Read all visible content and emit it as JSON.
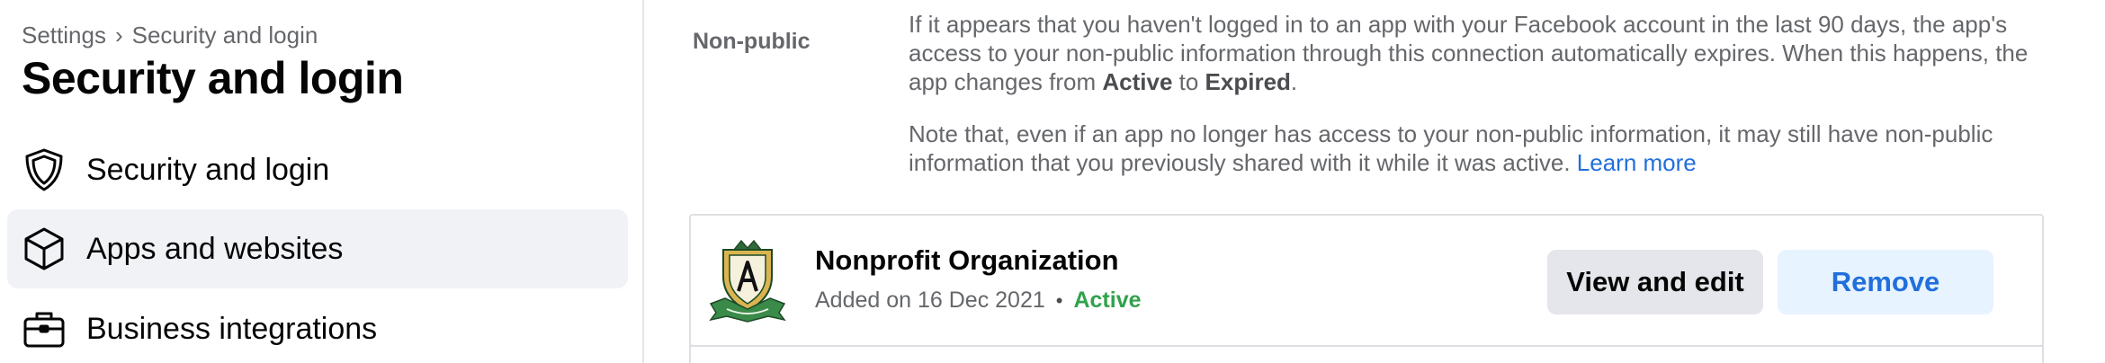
{
  "breadcrumb": {
    "parent": "Settings",
    "separator": "›",
    "current": "Security and login"
  },
  "page_title": "Security and login",
  "sidebar": {
    "items": [
      {
        "label": "Security and login",
        "icon": "shield-icon",
        "selected": false
      },
      {
        "label": "Apps and websites",
        "icon": "cube-icon",
        "selected": true
      },
      {
        "label": "Business integrations",
        "icon": "briefcase-icon",
        "selected": false
      }
    ]
  },
  "non_public": {
    "label": "Non-public",
    "para1_part1": "If it appears that you haven't logged in to an app with your Facebook account in the last 90 days, the app's access to your non-public information through this connection automatically expires. When this happens, the app changes from ",
    "para1_bold1": "Active",
    "para1_part2": " to ",
    "para1_bold2": "Expired",
    "para1_part3": ".",
    "para2_text": "Note that, even if an app no longer has access to your non-public information, it may still have non-public information that you previously shared with it while it was active. ",
    "learn_more": "Learn more"
  },
  "app": {
    "name": "Nonprofit Organization",
    "added_text": "Added on 16 Dec 2021",
    "separator": "•",
    "status": "Active",
    "logo_icon": "crest-logo-icon",
    "view_edit_label": "View and edit",
    "remove_label": "Remove"
  },
  "colors": {
    "accent_blue": "#216fdb",
    "active_green": "#31a24c",
    "selected_bg": "#f0f2f5",
    "secondary_text": "#65676b"
  }
}
